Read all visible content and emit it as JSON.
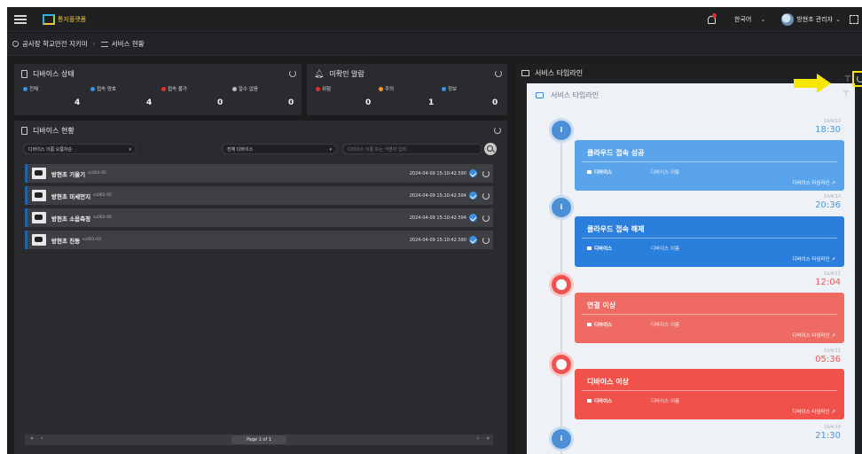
{
  "topbar": {
    "logo_text": "통지플랫폼",
    "language": "한국어",
    "user_name": "방현초 관리자"
  },
  "breadcrumb": {
    "root": "공사장 학교안전 지키미",
    "current": "서비스 현황"
  },
  "device_status": {
    "title": "디바이스 상태",
    "items": [
      {
        "label": "전체",
        "value": "4",
        "color": "#3a8ee6"
      },
      {
        "label": "접속 양호",
        "value": "4",
        "color": "#3a8ee6"
      },
      {
        "label": "접속 불가",
        "value": "0",
        "color": "#e0302e"
      },
      {
        "label": "알수 없음",
        "value": "0",
        "color": "#bdbdbd"
      }
    ]
  },
  "unack_alarms": {
    "title": "미확인 알람",
    "items": [
      {
        "label": "위험",
        "value": "0",
        "color": "#e0302e"
      },
      {
        "label": "주의",
        "value": "1",
        "color": "#f09a1e"
      },
      {
        "label": "정보",
        "value": "0",
        "color": "#3a8ee6"
      }
    ]
  },
  "device_list": {
    "title": "디바이스 현황",
    "sort_select": "디바이스 이름 오름차순",
    "filter_select": "전체 디바이스",
    "search_placeholder": "디바이스 이름 또는 식별자 입력",
    "rows": [
      {
        "name": "방현초 기울기",
        "id": "sc001-02",
        "time": "2024-04-09 15:10:42.590"
      },
      {
        "name": "방현초 미세먼지",
        "id": "sc001-05",
        "time": "2024-04-09 15:10:42.594"
      },
      {
        "name": "방현초 소음측정",
        "id": "sc001-06",
        "time": "2024-04-09 15:10:42.594"
      },
      {
        "name": "방현초 진동",
        "id": "sc001-03",
        "time": "2024-04-09 15:10:42.590"
      }
    ],
    "pager": {
      "info": "Page 1 of 1",
      "first": "«",
      "prev": "‹",
      "next": "›",
      "last": "»"
    }
  },
  "timeline": {
    "title": "서비스 타임라인",
    "inner_title": "서비스 타임라인",
    "events": [
      {
        "type": "info",
        "title": "클라우드 접속 성공",
        "date": "19/4/10",
        "time": "18:30",
        "device_label": "디바이스",
        "device_name": "디바이스 이름",
        "link": "디바이스 타임라인"
      },
      {
        "type": "info",
        "title": "클라우드 접속 해제",
        "date": "19/4/10",
        "time": "20:36",
        "device_label": "디바이스",
        "device_name": "디바이스 이름",
        "link": "디바이스 타임라인"
      },
      {
        "type": "error",
        "title": "연결 이상",
        "date": "19/4/11",
        "time": "12:04",
        "device_label": "디바이스",
        "device_name": "디바이스 이름",
        "link": "디바이스 타임라인"
      },
      {
        "type": "error",
        "title": "디바이스 이상",
        "date": "19/4/11",
        "time": "05:36",
        "device_label": "디바이스",
        "device_name": "디바이스 이름",
        "link": "디바이스 타임라인"
      },
      {
        "type": "info",
        "title": "",
        "date": "19/4/16",
        "time": "21:30",
        "device_label": "",
        "device_name": "",
        "link": ""
      }
    ]
  },
  "icons": {
    "menu": "hamburger-icon",
    "bell": "bell-icon",
    "refresh": "refresh-icon",
    "filter": "filter-icon",
    "search": "search-icon",
    "check": "check-circle-icon",
    "arrow": "yellow-arrow-annotation"
  },
  "colors": {
    "accent_blue": "#3a8ee6",
    "danger_red": "#ef5350",
    "highlight_yellow": "#f7e600"
  }
}
